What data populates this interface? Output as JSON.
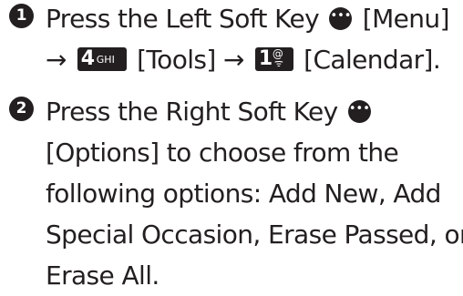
{
  "steps": [
    {
      "number": "1",
      "line1_before": "Press the Left Soft Key",
      "line1_after": "[Menu]",
      "line2_arrow1": "→",
      "key4_number": "4",
      "key4_letters": "GHI",
      "line2_mid": "[Tools]",
      "line2_arrow2": "→",
      "key1_number": "1",
      "key1_symbol": "@",
      "key1_voicemail": "ᯤ",
      "line2_end": "[Calendar]."
    },
    {
      "number": "2",
      "line1_before": "Press the Right Soft Key",
      "line2": "[Options] to choose from the",
      "line3": "following options: Add New, Add",
      "line4": "Special Occasion, Erase Passed, or",
      "line5": "Erase All."
    }
  ],
  "icons": {
    "soft_key_dots": "•••"
  }
}
